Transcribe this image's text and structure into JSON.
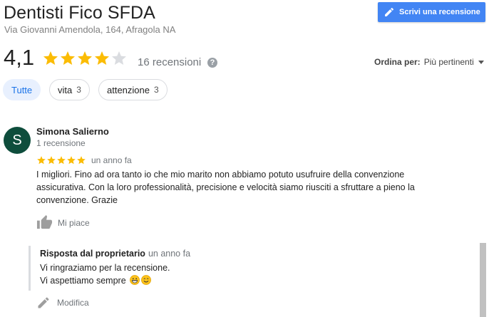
{
  "header": {
    "title": "Dentisti Fico SFDA",
    "address": "Via Giovanni Amendola, 164, Afragola NA",
    "write_review_label": "Scrivi una recensione"
  },
  "summary": {
    "rating": "4,1",
    "stars_filled": 4,
    "stars_total": 5,
    "review_count": "16 recensioni",
    "help_icon": "?"
  },
  "sort": {
    "label": "Ordina per:",
    "value": "Più pertinenti"
  },
  "filters": [
    {
      "label": "Tutte",
      "count": "",
      "active": true
    },
    {
      "label": "vita",
      "count": "3",
      "active": false
    },
    {
      "label": "attenzione",
      "count": "3",
      "active": false
    }
  ],
  "review": {
    "avatar_letter": "S",
    "avatar_color": "#0e4d3c",
    "name": "Simona Salierno",
    "subtitle": "1 recensione",
    "stars": 5,
    "time": "un anno fa",
    "text": "I migliori. Fino ad ora tanto io che mio marito non abbiamo potuto usufruire della convenzione assicurativa. Con la loro professionalità, precisione e velocità siamo riusciti a sfruttare a pieno la convenzione. Grazie",
    "like_label": "Mi piace"
  },
  "owner_reply": {
    "heading": "Risposta dal proprietario",
    "time": "un anno fa",
    "line1": "Vi ringraziamo per la recensione.",
    "line2": "Vi aspettiamo sempre",
    "emojis": [
      "grinning-face-icon",
      "smiling-face-icon"
    ],
    "edit_label": "Modifica"
  },
  "colors": {
    "accent": "#4285f4",
    "star": "#fbbc04",
    "star_empty": "#dadce0",
    "chip_active_bg": "#e8f0fe",
    "chip_active_text": "#1a73e8"
  }
}
